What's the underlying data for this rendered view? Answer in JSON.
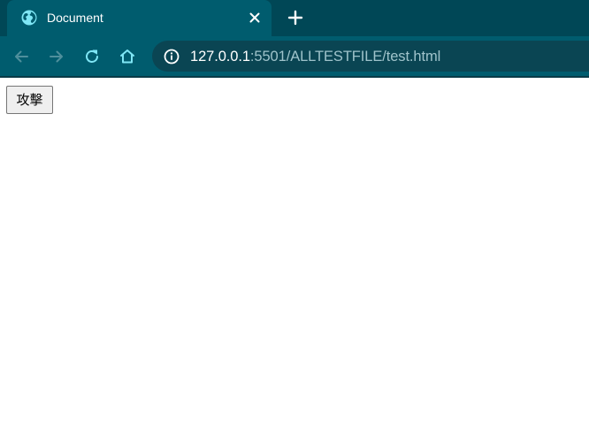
{
  "colors": {
    "tabstrip_bg": "#004756",
    "toolbar_bg": "#005c6e",
    "omnibox_bg": "#0a4553",
    "icon_active": "#ffffff",
    "icon_disabled": "#4f8f9c",
    "accent_icon": "#7fe6f5"
  },
  "tab": {
    "title": "Document",
    "icon": "globe-icon",
    "close_icon": "close-icon"
  },
  "tabstrip": {
    "new_tab_icon": "plus-icon"
  },
  "toolbar": {
    "back_icon": "arrow-left-icon",
    "forward_icon": "arrow-right-icon",
    "reload_icon": "reload-icon",
    "home_icon": "home-icon"
  },
  "address_bar": {
    "info_icon": "info-icon",
    "host": "127.0.0.1",
    "rest": ":5501/ALLTESTFILE/test.html"
  },
  "page": {
    "button_label": "攻擊"
  }
}
